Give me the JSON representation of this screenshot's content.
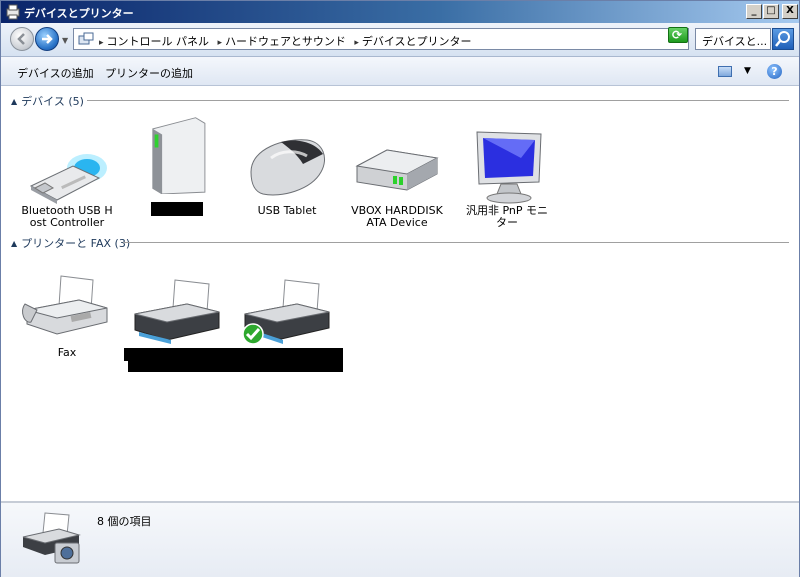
{
  "window": {
    "title": "デバイスとプリンター",
    "minimize": "_",
    "maximize": "□",
    "close": "X"
  },
  "address": {
    "crumbs": [
      "コントロール パネル",
      "ハードウェアとサウンド",
      "デバイスとプリンター"
    ],
    "search_text": "デバイスと..."
  },
  "commands": {
    "add_device": "デバイスの追加",
    "add_printer": "プリンターの追加",
    "help": "?"
  },
  "groups": {
    "devices": {
      "label": "デバイス (5)"
    },
    "printers": {
      "label": "プリンターと FAX (3)"
    }
  },
  "devices": [
    {
      "label": "Bluetooth USB Host Controller",
      "icon": "bluetooth-usb-icon"
    },
    {
      "label": "",
      "icon": "computer-tower-icon",
      "redacted": true
    },
    {
      "label": "USB Tablet",
      "icon": "mouse-icon"
    },
    {
      "label": "VBOX HARDDISK ATA Device",
      "icon": "hard-disk-icon"
    },
    {
      "label": "汎用非 PnP モニター",
      "icon": "monitor-icon"
    }
  ],
  "printers": [
    {
      "label": "Fax",
      "icon": "fax-icon"
    },
    {
      "label": "",
      "icon": "printer-icon",
      "redacted": true
    },
    {
      "label": "",
      "icon": "printer-default-icon",
      "redacted": true,
      "default": true
    }
  ],
  "status": {
    "count": "8 個の項目"
  },
  "colors": {
    "title_start": "#0a246a",
    "title_end": "#a6caf0",
    "group_text": "#1e395b",
    "default_check": "#2ea82e"
  }
}
